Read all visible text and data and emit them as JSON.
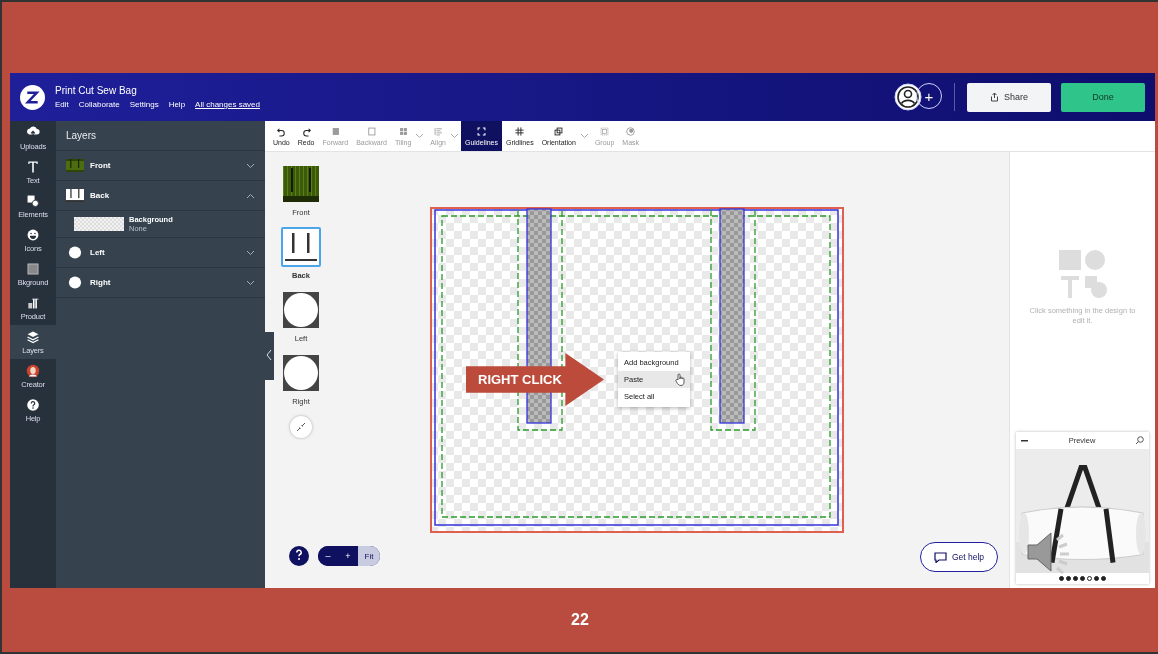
{
  "window": {
    "title": "Print Cut Sew Bag",
    "menu": [
      "Edit",
      "Collaborate",
      "Settings",
      "Help"
    ],
    "save_status": "All changes saved"
  },
  "header": {
    "add_collaborator": "+",
    "share": "Share",
    "done": "Done"
  },
  "rail": [
    {
      "label": "Uploads",
      "selected": false
    },
    {
      "label": "Text",
      "selected": false
    },
    {
      "label": "Elements",
      "selected": false
    },
    {
      "label": "Icons",
      "selected": false
    },
    {
      "label": "Bkground",
      "selected": false
    },
    {
      "label": "Product",
      "selected": false
    },
    {
      "label": "Layers",
      "selected": true
    },
    {
      "label": "Creator",
      "selected": false
    },
    {
      "label": "Help",
      "selected": false
    }
  ],
  "layers_panel": {
    "title": "Layers",
    "layers": [
      {
        "name": "Front",
        "kind": "pattern",
        "expanded": false
      },
      {
        "name": "Back",
        "kind": "panel",
        "expanded": true,
        "children": [
          {
            "name": "Background",
            "value": "None"
          }
        ]
      },
      {
        "name": "Left",
        "kind": "round",
        "expanded": false
      },
      {
        "name": "Right",
        "kind": "round",
        "expanded": false
      }
    ]
  },
  "toolbar": [
    {
      "label": "Undo",
      "disabled": false,
      "selected": false,
      "dropdown": false
    },
    {
      "label": "Redo",
      "disabled": false,
      "selected": false,
      "dropdown": false
    },
    {
      "label": "Forward",
      "disabled": true,
      "selected": false,
      "dropdown": false
    },
    {
      "label": "Backward",
      "disabled": true,
      "selected": false,
      "dropdown": false
    },
    {
      "label": "Tiling",
      "disabled": true,
      "selected": false,
      "dropdown": true
    },
    {
      "label": "Align",
      "disabled": true,
      "selected": false,
      "dropdown": true
    },
    {
      "label": "Guidelines",
      "disabled": false,
      "selected": true,
      "dropdown": false
    },
    {
      "label": "Gridlines",
      "disabled": false,
      "selected": false,
      "dropdown": false
    },
    {
      "label": "Orientation",
      "disabled": false,
      "selected": false,
      "dropdown": true
    },
    {
      "label": "Group",
      "disabled": true,
      "selected": false,
      "dropdown": false
    },
    {
      "label": "Mask",
      "disabled": true,
      "selected": false,
      "dropdown": false
    }
  ],
  "pages": [
    {
      "label": "Front",
      "kind": "pattern",
      "selected": false
    },
    {
      "label": "Back",
      "kind": "panel",
      "selected": true
    },
    {
      "label": "Left",
      "kind": "round",
      "selected": false
    },
    {
      "label": "Right",
      "kind": "round",
      "selected": false
    }
  ],
  "callout": "RIGHT CLICK",
  "context_menu": [
    {
      "label": "Add background",
      "selected": false
    },
    {
      "label": "Paste",
      "selected": true
    },
    {
      "label": "Select all",
      "selected": false
    }
  ],
  "zoom": {
    "minus": "–",
    "plus": "+",
    "fit": "Fit"
  },
  "get_help": "Get help",
  "empty_state": "Click something in the design to edit it.",
  "preview": {
    "title": "Preview",
    "dots": [
      {
        "selected": false
      },
      {
        "selected": false
      },
      {
        "selected": false
      },
      {
        "selected": false
      },
      {
        "selected": true
      },
      {
        "selected": false
      },
      {
        "selected": false
      }
    ]
  },
  "slide_number": "22"
}
